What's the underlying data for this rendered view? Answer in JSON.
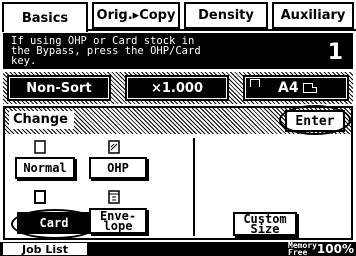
{
  "tabs": [
    {
      "label": "Basics",
      "active": true
    },
    {
      "label": "Orig.▸Copy",
      "active": false
    },
    {
      "label": "Density",
      "active": false
    },
    {
      "label": "Auxiliary",
      "active": false
    }
  ],
  "message": {
    "text": "If using OHP or Card stock in\nthe Bypass, press the OHP/Card\nkey.",
    "count": "1"
  },
  "status": {
    "sort": "Non-Sort",
    "zoom": "×1.000",
    "paper_size": "A4"
  },
  "change_panel": {
    "label": "Change",
    "enter_label": "Enter",
    "options": {
      "normal": "Normal",
      "ohp": "OHP",
      "card": "Card",
      "envelope_line1": "Enve-",
      "envelope_line2": "lope",
      "custom_line1": "Custom",
      "custom_line2": "Size"
    },
    "selected": "Card"
  },
  "footer": {
    "job_list": "Job List",
    "memory_line1": "Memory",
    "memory_line2": "Free",
    "memory_value": "100%"
  }
}
